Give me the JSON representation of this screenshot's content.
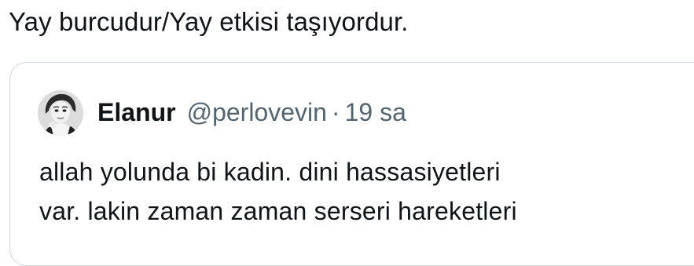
{
  "post": {
    "text": "Yay burcudur/Yay etkisi taşıyordur."
  },
  "quoted_post": {
    "author": {
      "display_name": "Elanur",
      "handle": "@perlovevin"
    },
    "separator": "·",
    "time": "19 sa",
    "text_lines": [
      "allah yolunda bi kadin. dini hassasiyetleri",
      "var. lakin zaman zaman serseri hareketleri"
    ]
  },
  "colors": {
    "text_primary": "#0f1419",
    "text_secondary": "#536471",
    "border": "#cfd9de"
  }
}
